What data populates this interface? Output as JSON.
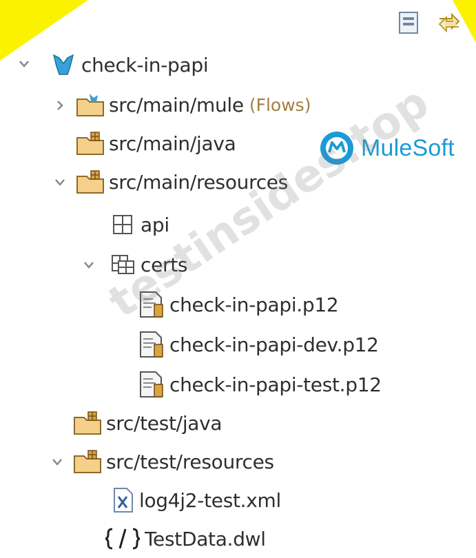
{
  "project": {
    "name": "check-in-papi"
  },
  "tree": {
    "src_main_mule": {
      "label": "src/main/mule",
      "suffix": "(Flows)"
    },
    "src_main_java": {
      "label": "src/main/java"
    },
    "src_main_resources": {
      "label": "src/main/resources"
    },
    "api": {
      "label": "api"
    },
    "certs": {
      "label": "certs"
    },
    "cert1": {
      "label": "check-in-papi.p12"
    },
    "cert2": {
      "label": "check-in-papi-dev.p12"
    },
    "cert3": {
      "label": "check-in-papi-test.p12"
    },
    "src_test_java": {
      "label": "src/test/java"
    },
    "src_test_resources": {
      "label": "src/test/resources"
    },
    "log4j2": {
      "label": "log4j2-test.xml"
    },
    "testdata": {
      "label": "TestData.dwl"
    }
  },
  "branding": {
    "mulesoft": "MuleSoft",
    "watermark": "testinsides.top",
    "accent": "#1b9ad7",
    "highlight": "#fbf200"
  },
  "icons": {
    "collapse_all": "collapse-all-icon",
    "link_editor": "link-with-editor-icon"
  }
}
